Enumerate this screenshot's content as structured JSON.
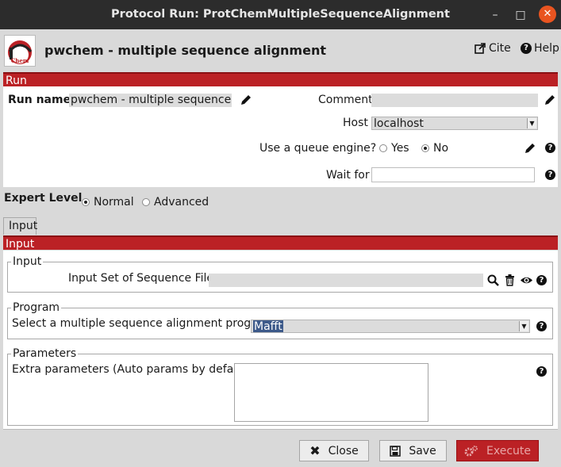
{
  "window": {
    "title": "Protocol Run: ProtChemMultipleSequenceAlignment"
  },
  "header": {
    "protocol_title": "pwchem - multiple sequence alignment",
    "cite_label": "Cite",
    "help_label": "Help",
    "logo_text": "Chem"
  },
  "run": {
    "section_label": "Run",
    "run_name_label": "Run name",
    "run_name_value": "pwchem - multiple sequence alig",
    "comment_label": "Comment",
    "comment_value": "",
    "host_label": "Host",
    "host_value": "localhost",
    "queue_label": "Use a queue engine?",
    "queue_yes": "Yes",
    "queue_no": "No",
    "queue_selected": "No",
    "wait_label": "Wait for",
    "wait_value": ""
  },
  "expert": {
    "label": "Expert Level",
    "normal": "Normal",
    "advanced": "Advanced",
    "selected": "Normal"
  },
  "tabs": [
    {
      "label": "Input"
    }
  ],
  "input_section": {
    "section_label": "Input",
    "input_group": {
      "legend": "Input",
      "field_label": "Input Set of Sequence File:",
      "value": ""
    },
    "program_group": {
      "legend": "Program",
      "field_label": "Select a multiple sequence alignment program:",
      "value": "Mafft"
    },
    "params_group": {
      "legend": "Parameters",
      "field_label": "Extra parameters (Auto params by default):",
      "value": ""
    }
  },
  "buttons": {
    "close": "Close",
    "save": "Save",
    "execute": "Execute"
  },
  "colors": {
    "accent": "#bb2125",
    "titlebar": "#2c2c2c",
    "close_circle": "#e95420"
  }
}
